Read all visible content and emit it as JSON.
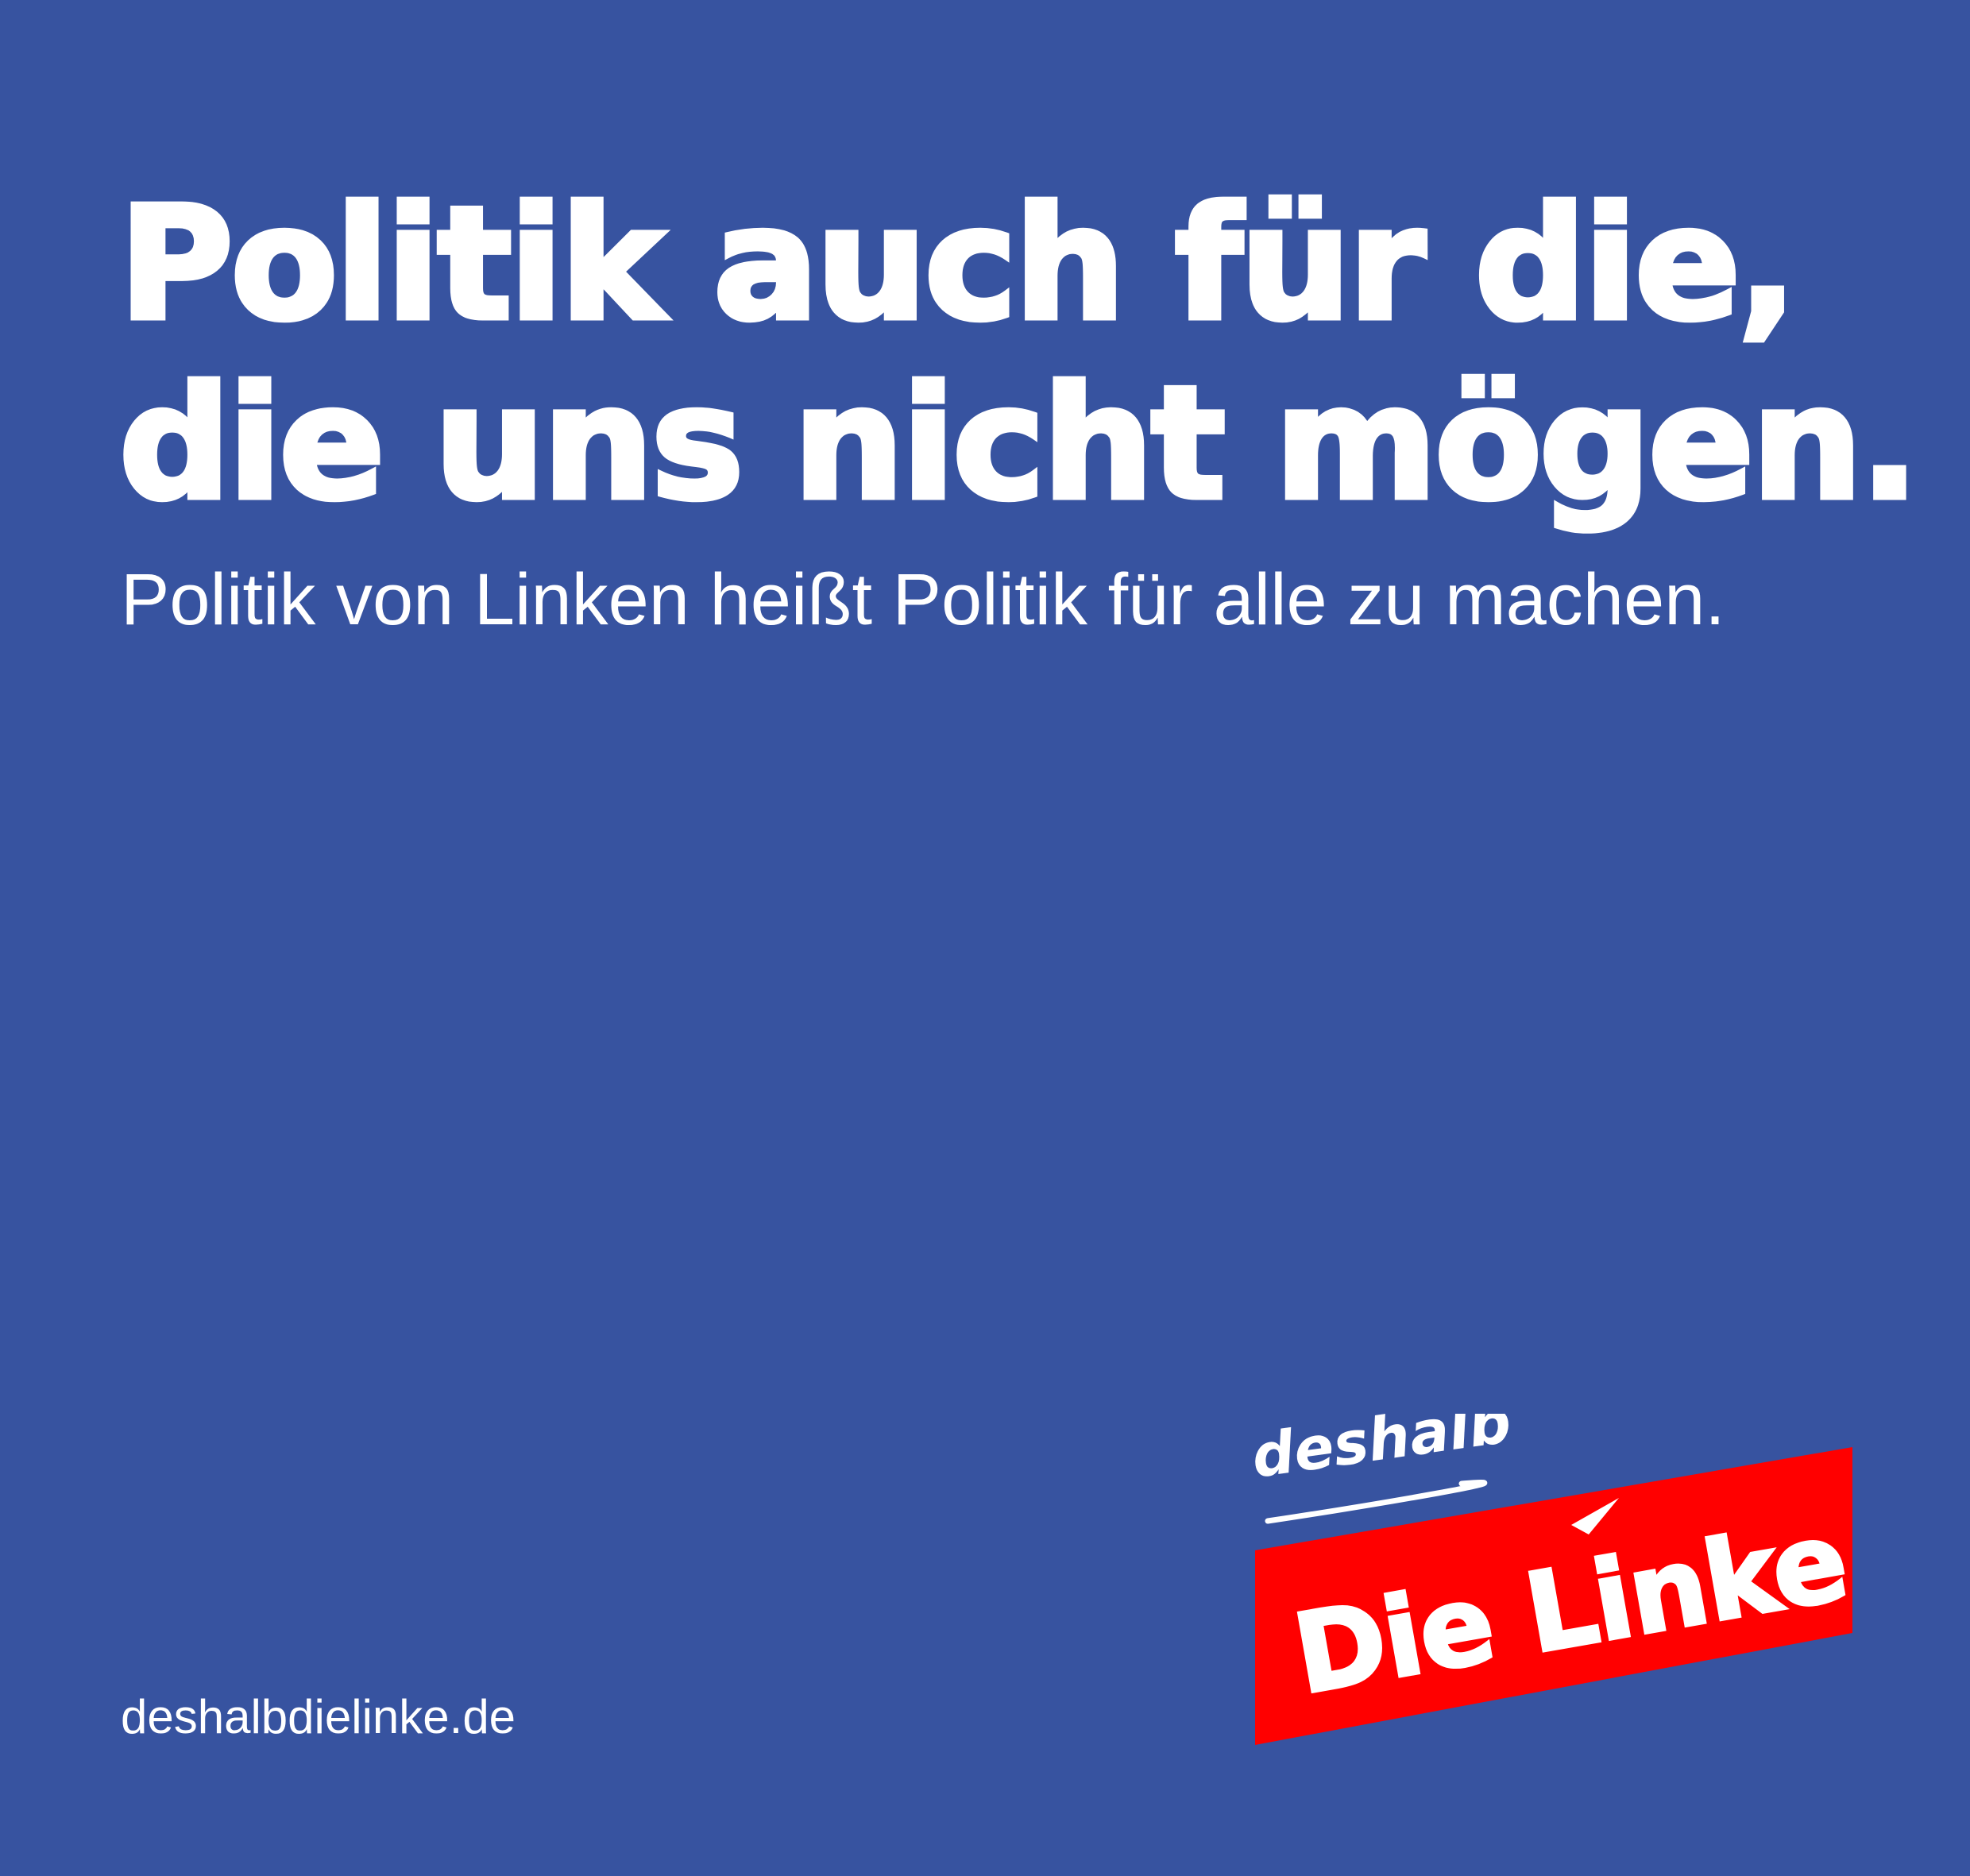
{
  "headline": {
    "line1": "Politik auch für die,",
    "line2": "die uns nicht mögen."
  },
  "subline": "Politik von Linken heißt Politik für alle zu machen.",
  "url": "deshalbdielinke.de",
  "logo": {
    "tagline": "deshalb",
    "party_name": "Die Linke"
  },
  "colors": {
    "background": "#3753a0",
    "text": "#ffffff",
    "logo_red": "#ff0000"
  }
}
